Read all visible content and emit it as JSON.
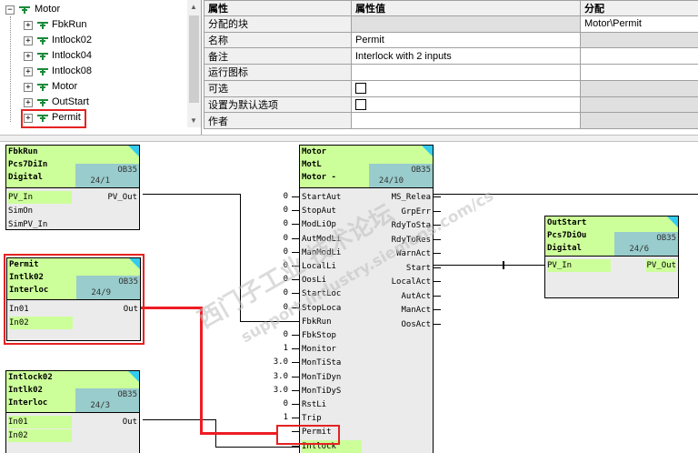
{
  "tree": {
    "root": "Motor",
    "items": [
      "FbkRun",
      "Intlock02",
      "Intlock04",
      "Intlock08",
      "Motor",
      "OutStart",
      "Permit"
    ]
  },
  "props": {
    "headers": [
      "属性",
      "属性值",
      "分配"
    ],
    "rows": [
      {
        "key": "分配的块",
        "value": "",
        "assign": "Motor\\Permit"
      },
      {
        "key": "名称",
        "value": "Permit",
        "assign": ""
      },
      {
        "key": "备注",
        "value": "Interlock with 2 inputs",
        "assign": ""
      },
      {
        "key": "运行图标",
        "value": "",
        "assign": ""
      },
      {
        "key": "可选",
        "value": "",
        "assign": ""
      },
      {
        "key": "设置为默认选项",
        "value": "",
        "assign": ""
      },
      {
        "key": "作者",
        "value": "",
        "assign": ""
      }
    ]
  },
  "blocks": {
    "fbkrun": {
      "head": [
        "FbkRun",
        "Pcs7DiIn",
        "Digital"
      ],
      "ob": "OB35",
      "seq": "24/1",
      "inputs": [
        "PV_In",
        "SimOn",
        "SimPV_In"
      ],
      "outputs": [
        "PV_Out"
      ]
    },
    "permit": {
      "head": [
        "Permit",
        "Intlk02",
        "Interloc"
      ],
      "ob": "OB35",
      "seq": "24/9",
      "inputs": [
        "In01",
        "In02"
      ],
      "outputs": [
        "Out"
      ]
    },
    "intlock02": {
      "head": [
        "Intlock02",
        "Intlk02",
        "Interloc"
      ],
      "ob": "OB35",
      "seq": "24/3",
      "inputs": [
        "In01",
        "In02"
      ],
      "outputs": [
        "Out"
      ]
    },
    "motor": {
      "head": [
        "Motor",
        "MotL",
        "Motor -"
      ],
      "ob": "OB35",
      "seq": "24/10",
      "inputs": [
        "StartAut",
        "StopAut",
        "ModLiOp",
        "AutModLi",
        "ManModLi",
        "LocalLi",
        "OosLi",
        "StartLoc",
        "StopLoca",
        "FbkRun",
        "FbkStop",
        "Monitor",
        "MonTiSta",
        "MonTiDyn",
        "MonTiDyS",
        "RstLi",
        "Trip",
        "Permit",
        "Intlock"
      ],
      "input_values": [
        "0",
        "0",
        "0",
        "0",
        "0",
        "0",
        "0",
        "0",
        "0",
        "",
        "0",
        "1",
        "3.0",
        "3.0",
        "3.0",
        "0",
        "1",
        "",
        ""
      ],
      "outputs": [
        "MS_Relea",
        "GrpErr",
        "RdyToSta",
        "RdyToRes",
        "WarnAct",
        "Start",
        "LocalAct",
        "AutAct",
        "ManAct",
        "OosAct"
      ]
    },
    "outstart": {
      "head": [
        "OutStart",
        "Pcs7DiOu",
        "Digital"
      ],
      "ob": "OB35",
      "seq": "24/6",
      "inputs": [
        "PV_In"
      ],
      "outputs": [
        "PV_Out"
      ]
    }
  },
  "watermark": {
    "line1": "西门子工业  技术论坛",
    "line2": "support.industry.siemens.com/cs"
  }
}
